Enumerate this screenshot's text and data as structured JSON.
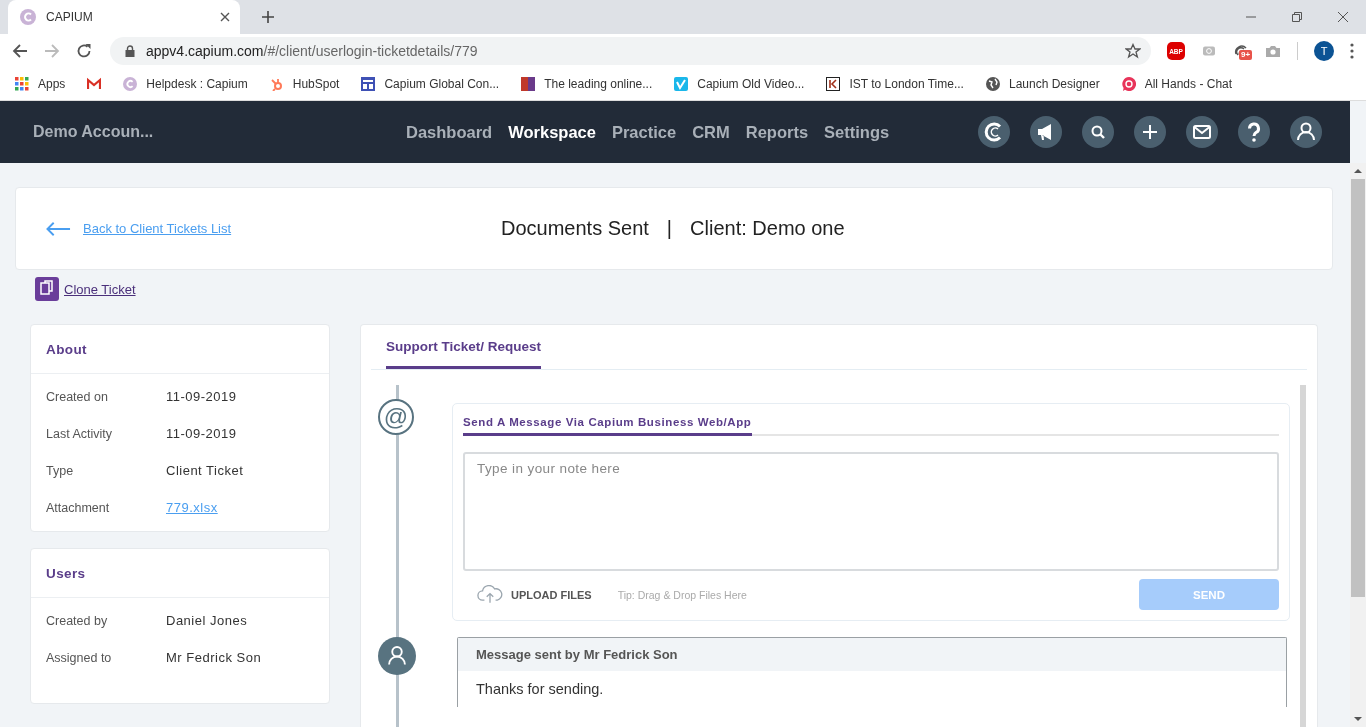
{
  "browser": {
    "tab_title": "CAPIUM",
    "url_host": "appv4.capium.com",
    "url_path": "/#/client/userlogin-ticketdetails/779",
    "extension_label": "ABP",
    "extension_badge": "9+",
    "profile_initial": "T",
    "bookmarks": [
      {
        "label": "Apps",
        "kind": "apps"
      },
      {
        "kind": "gmail"
      },
      {
        "label": "Helpdesk : Capium",
        "kind": "capium"
      },
      {
        "label": "HubSpot",
        "kind": "hubspot"
      },
      {
        "label": "Capium Global Con...",
        "kind": "form"
      },
      {
        "label": "The leading online...",
        "kind": "aw"
      },
      {
        "label": "Capium Old Video...",
        "kind": "vimeo"
      },
      {
        "label": "IST to London Time...",
        "kind": "clock"
      },
      {
        "label": "Launch Designer",
        "kind": "globe"
      },
      {
        "label": "All Hands - Chat",
        "kind": "chat"
      }
    ]
  },
  "app": {
    "account": "Demo Accoun...",
    "nav": [
      {
        "label": "Dashboard",
        "selected": false
      },
      {
        "label": "Workspace",
        "selected": true
      },
      {
        "label": "Practice",
        "selected": false
      },
      {
        "label": "CRM",
        "selected": false
      },
      {
        "label": "Reports",
        "selected": false
      },
      {
        "label": "Settings",
        "selected": false
      }
    ]
  },
  "header": {
    "back_link": "Back to Client Tickets List",
    "title": "Documents Sent",
    "separator": "|",
    "client": "Client: Demo one"
  },
  "clone_link": "Clone Ticket",
  "about": {
    "title": "About",
    "rows": [
      {
        "label": "Created on",
        "value": "11-09-2019",
        "kind": "text"
      },
      {
        "label": "Last Activity",
        "value": "11-09-2019",
        "kind": "text"
      },
      {
        "label": "Type",
        "value": "Client Ticket",
        "kind": "text"
      },
      {
        "label": "Attachment",
        "value": "779.xlsx",
        "kind": "link"
      }
    ]
  },
  "users": {
    "title": "Users",
    "rows": [
      {
        "label": "Created by",
        "value": "Daniel Jones",
        "kind": "text"
      },
      {
        "label": "Assigned to",
        "value": "Mr Fedrick Son",
        "kind": "text"
      }
    ]
  },
  "ticket": {
    "tabs": [
      {
        "label": "Support Ticket/ Request",
        "selected": true
      }
    ],
    "marker": "@",
    "compose": {
      "tabs": [
        {
          "label": "Send A Message Via Capium Business Web/App",
          "selected": true
        }
      ],
      "placeholder": "Type in your note here",
      "upload": "UPLOAD FILES",
      "tip": "Tip: Drag & Drop Files Here",
      "send": {
        "label": "SEND",
        "disabled": true
      }
    },
    "message": {
      "header": "Message sent by Mr Fedrick Son",
      "body": "Thanks for sending."
    }
  }
}
